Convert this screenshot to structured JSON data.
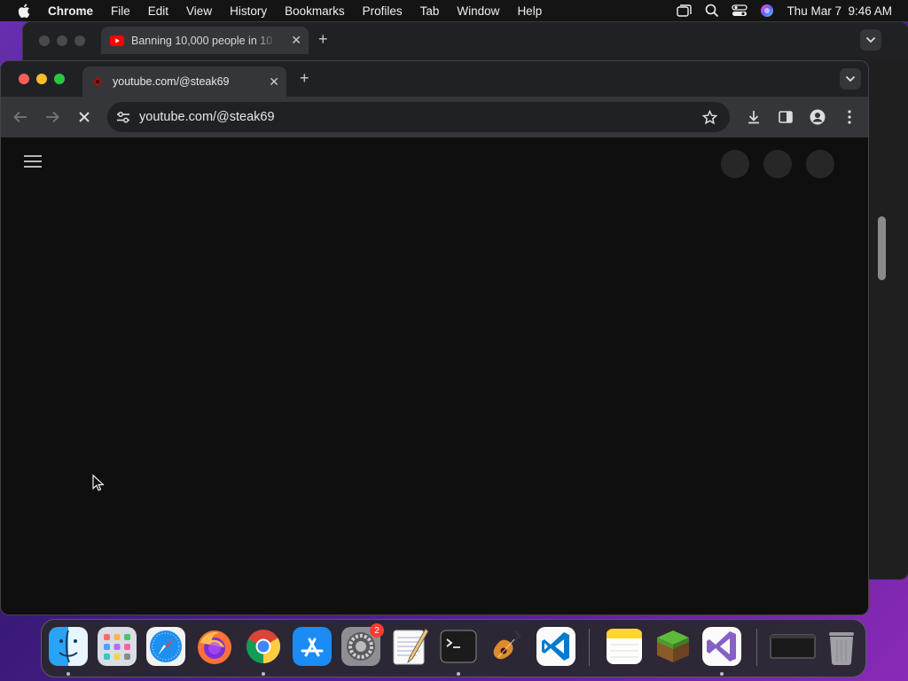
{
  "menubar": {
    "app_name": "Chrome",
    "items": [
      "File",
      "Edit",
      "View",
      "History",
      "Bookmarks",
      "Profiles",
      "Tab",
      "Window",
      "Help"
    ],
    "datetime": "Thu Mar 7  9:46 AM",
    "icons": [
      "apple-icon",
      "stage-manager-icon",
      "spotlight-search-icon",
      "control-center-icon",
      "siri-icon"
    ]
  },
  "back_window": {
    "tab_title": "Banning 10,000 people in 10",
    "tab_favicon": "youtube-icon"
  },
  "front_window": {
    "tab_title": "youtube.com/@steak69",
    "tab_favicon": "youtube-icon",
    "url": "youtube.com/@steak69",
    "loading": true
  },
  "dock": {
    "apps": [
      "Finder",
      "Launchpad",
      "Safari",
      "Firefox",
      "Google Chrome",
      "App Store",
      "System Settings",
      "TextEdit",
      "Terminal",
      "GarageBand",
      "Visual Studio Code",
      "Notes",
      "Minecraft",
      "Visual Studio",
      "Window Preview",
      "Trash"
    ],
    "badges": {
      "System Settings": "2"
    },
    "running": [
      "Finder",
      "Google Chrome",
      "Terminal",
      "Visual Studio"
    ]
  },
  "colors": {
    "accent_red": "#ff0000",
    "page_background": "#0f0f0f",
    "toolbar": "#35363a"
  }
}
